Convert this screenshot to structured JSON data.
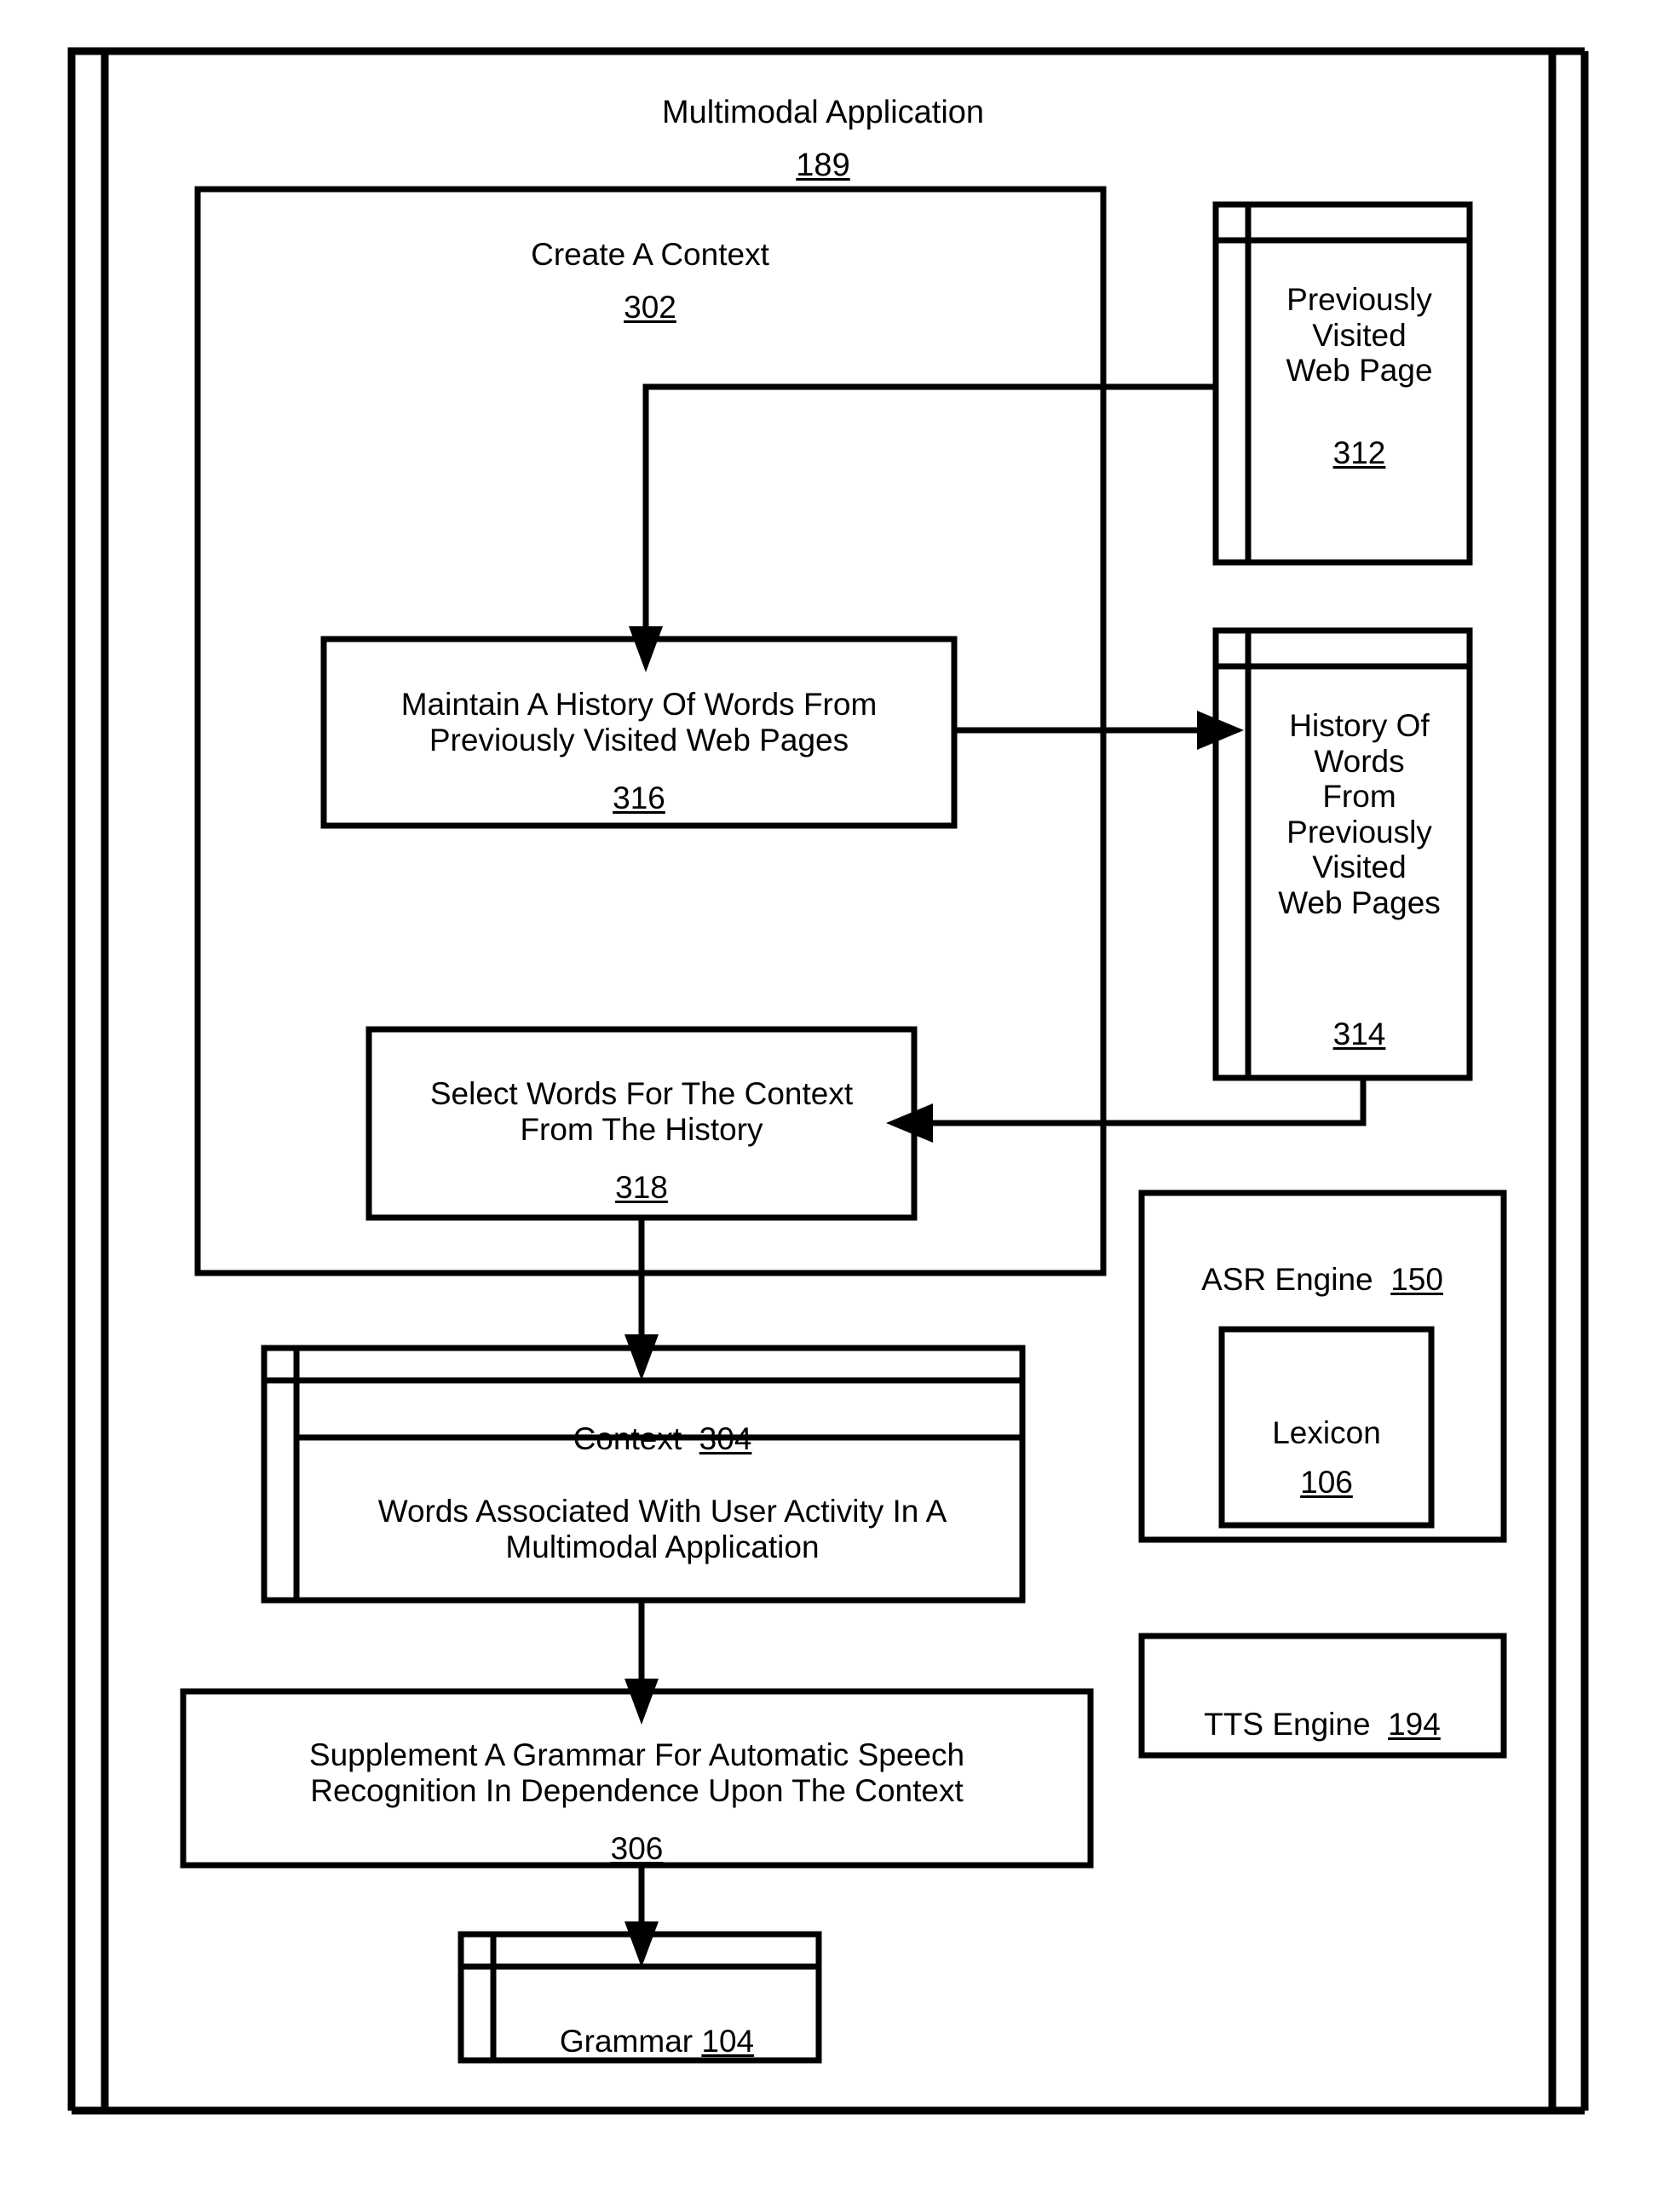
{
  "figure": {
    "title": "Multimodal Application",
    "title_ref": "189"
  },
  "containers": {
    "create_context": {
      "label": "Create A Context",
      "ref": "302"
    },
    "asr_engine": {
      "label": "ASR Engine",
      "ref": "150",
      "children": {
        "lexicon": {
          "label": "Lexicon",
          "ref": "106"
        }
      }
    },
    "tts_engine": {
      "label": "TTS Engine",
      "ref": "194"
    }
  },
  "process_boxes": [
    {
      "id": "maintain-history",
      "label": "Maintain A History Of Words From\nPreviously Visited Web Pages",
      "ref": "316"
    },
    {
      "id": "select-words",
      "label": "Select Words For The Context\nFrom The History",
      "ref": "318"
    },
    {
      "id": "supplement-grammar",
      "label": "Supplement A Grammar For Automatic Speech\nRecognition In Dependence Upon The Context",
      "ref": "306"
    }
  ],
  "data_boxes": [
    {
      "id": "previously-visited-web-page",
      "label": "Previously\nVisited\nWeb Page",
      "ref": "312"
    },
    {
      "id": "history-of-words",
      "label": "History Of\nWords\nFrom\nPreviously\nVisited\nWeb Pages",
      "ref": "314"
    },
    {
      "id": "context",
      "header_label": "Context",
      "ref": "304",
      "body_label": "Words Associated With User Activity In A\nMultimodal Application"
    },
    {
      "id": "grammar",
      "label": "Grammar",
      "ref": "104"
    }
  ],
  "style": {
    "stroke": "#000000",
    "fill": "#ffffff",
    "background": "#ffffff"
  }
}
